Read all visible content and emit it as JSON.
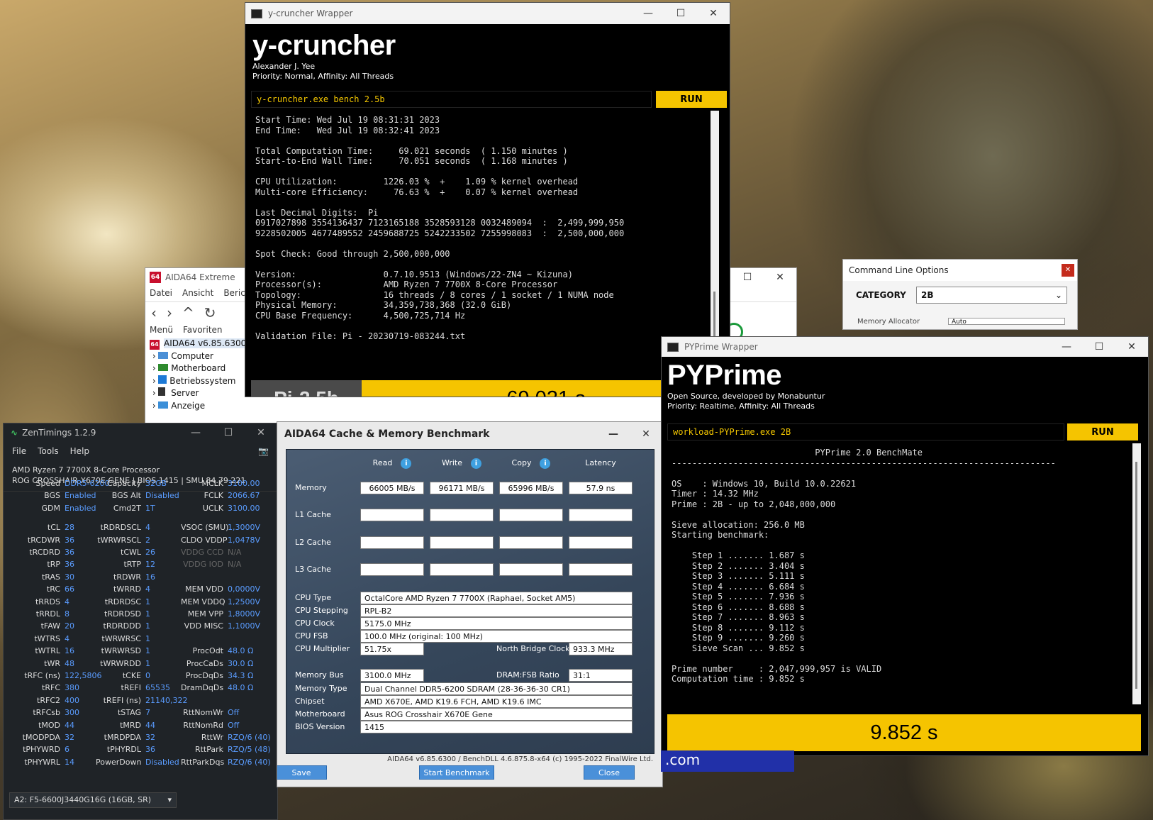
{
  "ycruncher": {
    "window_title": "y-cruncher Wrapper",
    "app_title": "y-cruncher",
    "author": "Alexander J. Yee",
    "priority": "Priority: Normal, Affinity: All Threads",
    "command": "y-cruncher.exe bench 2.5b",
    "run_label": "RUN",
    "console_lines": [
      "Start Time: Wed Jul 19 08:31:31 2023",
      "End Time:   Wed Jul 19 08:32:41 2023",
      "",
      "Total Computation Time:     69.021 seconds  ( 1.150 minutes )",
      "Start-to-End Wall Time:     70.051 seconds  ( 1.168 minutes )",
      "",
      "CPU Utilization:         1226.03 %  +    1.09 % kernel overhead",
      "Multi-core Efficiency:     76.63 %  +    0.07 % kernel overhead",
      "",
      "Last Decimal Digits:  Pi",
      "0917027898 3554136437 7123165188 3528593128 0032489094  :  2,499,999,950",
      "9228502005 4677489552 2459688725 5242233502 7255998083  :  2,500,000,000",
      "",
      "Spot Check: Good through 2,500,000,000",
      "",
      "Version:                 0.7.10.9513 (Windows/22-ZN4 ~ Kizuna)",
      "Processor(s):            AMD Ryzen 7 7700X 8-Core Processor",
      "Topology:                16 threads / 8 cores / 1 socket / 1 NUMA node",
      "Physical Memory:         34,359,738,368 (32.0 GiB)",
      "CPU Base Frequency:      4,500,725,714 Hz",
      "",
      "Validation File: Pi - 20230719-083244.txt"
    ],
    "bench_name": "Pi-2.5b",
    "result": "69.021 s"
  },
  "aida_extreme": {
    "title": "AIDA64 Extreme",
    "menu": [
      "Datei",
      "Ansicht",
      "Bericht"
    ],
    "tabs": [
      "Menü",
      "Favoriten"
    ],
    "tree": [
      "AIDA64 v6.85.6300",
      "Computer",
      "Motherboard",
      "Betriebssystem",
      "Server",
      "Anzeige"
    ]
  },
  "cmdline": {
    "title": "Command Line Options",
    "category_label": "CATEGORY",
    "category_value": "2B",
    "hidden_label": "Memory Allocator",
    "hidden_value": "Auto"
  },
  "zentimings": {
    "title": "ZenTimings 1.2.9",
    "menu": [
      "File",
      "Tools",
      "Help"
    ],
    "cpu": "AMD Ryzen 7 7700X 8-Core Processor",
    "board": "ROG CROSSHAIR X670E GENE | BIOS 1415 | SMU 84.79.221",
    "rows": [
      [
        [
          "Speed",
          "DDR5-6200"
        ],
        [
          "Capacity",
          "32GB"
        ],
        [
          "MCLK",
          "3100.00"
        ]
      ],
      [
        [
          "BGS",
          "Enabled"
        ],
        [
          "BGS Alt",
          "Disabled"
        ],
        [
          "FCLK",
          "2066.67"
        ]
      ],
      [
        [
          "GDM",
          "Enabled"
        ],
        [
          "Cmd2T",
          "1T"
        ],
        [
          "UCLK",
          "3100.00"
        ]
      ],
      [],
      [
        [
          "tCL",
          "28"
        ],
        [
          "tRDRDSCL",
          "4"
        ],
        [
          "VSOC (SMU)",
          "1,3000V"
        ]
      ],
      [
        [
          "tRCDWR",
          "36"
        ],
        [
          "tWRWRSCL",
          "2"
        ],
        [
          "CLDO VDDP",
          "1,0478V"
        ]
      ],
      [
        [
          "tRCDRD",
          "36"
        ],
        [
          "tCWL",
          "26"
        ],
        [
          "VDDG CCD",
          "N/A"
        ]
      ],
      [
        [
          "tRP",
          "36"
        ],
        [
          "tRTP",
          "12"
        ],
        [
          "VDDG IOD",
          "N/A"
        ]
      ],
      [
        [
          "tRAS",
          "30"
        ],
        [
          "tRDWR",
          "16"
        ],
        [
          "",
          ""
        ]
      ],
      [
        [
          "tRC",
          "66"
        ],
        [
          "tWRRD",
          "4"
        ],
        [
          "MEM VDD",
          "0,0000V"
        ]
      ],
      [
        [
          "tRRDS",
          "4"
        ],
        [
          "tRDRDSC",
          "1"
        ],
        [
          "MEM VDDQ",
          "1,2500V"
        ]
      ],
      [
        [
          "tRRDL",
          "8"
        ],
        [
          "tRDRDSD",
          "1"
        ],
        [
          "MEM VPP",
          "1,8000V"
        ]
      ],
      [
        [
          "tFAW",
          "20"
        ],
        [
          "tRDRDDD",
          "1"
        ],
        [
          "VDD MISC",
          "1,1000V"
        ]
      ],
      [
        [
          "tWTRS",
          "4"
        ],
        [
          "tWRWRSC",
          "1"
        ],
        [
          "",
          ""
        ]
      ],
      [
        [
          "tWTRL",
          "16"
        ],
        [
          "tWRWRSD",
          "1"
        ],
        [
          "ProcOdt",
          "48.0 Ω"
        ]
      ],
      [
        [
          "tWR",
          "48"
        ],
        [
          "tWRWRDD",
          "1"
        ],
        [
          "ProcCaDs",
          "30.0 Ω"
        ]
      ],
      [
        [
          "tRFC (ns)",
          "122,5806"
        ],
        [
          "tCKE",
          "0"
        ],
        [
          "ProcDqDs",
          "34.3 Ω"
        ]
      ],
      [
        [
          "tRFC",
          "380"
        ],
        [
          "tREFI",
          "65535"
        ],
        [
          "DramDqDs",
          "48.0 Ω"
        ]
      ],
      [
        [
          "tRFC2",
          "400"
        ],
        [
          "tREFI (ns)",
          "21140,322"
        ],
        [
          "",
          ""
        ]
      ],
      [
        [
          "tRFCsb",
          "300"
        ],
        [
          "tSTAG",
          "7"
        ],
        [
          "RttNomWr",
          "Off"
        ]
      ],
      [
        [
          "tMOD",
          "44"
        ],
        [
          "tMRD",
          "44"
        ],
        [
          "RttNomRd",
          "Off"
        ]
      ],
      [
        [
          "tMODPDA",
          "32"
        ],
        [
          "tMRDPDA",
          "32"
        ],
        [
          "RttWr",
          "RZQ/6 (40)"
        ]
      ],
      [
        [
          "tPHYWRD",
          "6"
        ],
        [
          "tPHYRDL",
          "36"
        ],
        [
          "RttPark",
          "RZQ/5 (48)"
        ]
      ],
      [
        [
          "tPHYWRL",
          "14"
        ],
        [
          "PowerDown",
          "Disabled"
        ],
        [
          "RttParkDqs",
          "RZQ/6 (40)"
        ]
      ]
    ],
    "dimm": "A2: F5-6600J3440G16G (16GB, SR)"
  },
  "bench": {
    "title": "AIDA64 Cache & Memory Benchmark",
    "headers": [
      "Read",
      "Write",
      "Copy",
      "Latency"
    ],
    "rows": [
      {
        "label": "Memory",
        "values": [
          "66005 MB/s",
          "96171 MB/s",
          "65996 MB/s",
          "57.9 ns"
        ]
      },
      {
        "label": "L1 Cache",
        "values": [
          "",
          "",
          "",
          ""
        ]
      },
      {
        "label": "L2 Cache",
        "values": [
          "",
          "",
          "",
          ""
        ]
      },
      {
        "label": "L3 Cache",
        "values": [
          "",
          "",
          "",
          ""
        ]
      }
    ],
    "info": [
      {
        "label": "CPU Type",
        "value": "OctalCore AMD Ryzen 7 7700X  (Raphael, Socket AM5)"
      },
      {
        "label": "CPU Stepping",
        "value": "RPL-B2"
      },
      {
        "label": "CPU Clock",
        "value": "5175.0 MHz"
      },
      {
        "label": "CPU FSB",
        "value": "100.0 MHz  (original: 100 MHz)"
      }
    ],
    "cpu_multiplier_label": "CPU Multiplier",
    "cpu_multiplier": "51.75x",
    "nb_label": "North Bridge Clock",
    "nb_value": "933.3 MHz",
    "membus_label": "Memory Bus",
    "membus": "3100.0 MHz",
    "ratio_label": "DRAM:FSB Ratio",
    "ratio": "31:1",
    "info2": [
      {
        "label": "Memory Type",
        "value": "Dual Channel DDR5-6200 SDRAM  (28-36-36-30 CR1)"
      },
      {
        "label": "Chipset",
        "value": "AMD X670E, AMD K19.6 FCH, AMD K19.6 IMC"
      },
      {
        "label": "Motherboard",
        "value": "Asus ROG Crosshair X670E Gene"
      },
      {
        "label": "BIOS Version",
        "value": "1415"
      }
    ],
    "footer": "AIDA64 v6.85.6300 / BenchDLL 4.6.875.8-x64  (c) 1995-2022 FinalWire Ltd.",
    "save": "Save",
    "start": "Start Benchmark",
    "close": "Close"
  },
  "pyprime": {
    "window_title": "PYPrime Wrapper",
    "app_title": "PYPrime",
    "sub1": "Open Source, developed by Monabuntur",
    "sub2": "Priority: Realtime, Affinity: All Threads",
    "command": "workload-PYPrime.exe 2B",
    "run_label": "RUN",
    "console_lines": [
      "                            PYPrime 2.0 BenchMate",
      "---------------------------------------------------------------------------",
      "",
      "OS    : Windows 10, Build 10.0.22621",
      "Timer : 14.32 MHz",
      "Prime : 2B - up to 2,048,000,000",
      "",
      "Sieve allocation: 256.0 MB",
      "Starting benchmark:",
      "",
      "    Step 1 ....... 1.687 s",
      "    Step 2 ....... 3.404 s",
      "    Step 3 ....... 5.111 s",
      "    Step 4 ....... 6.684 s",
      "    Step 5 ....... 7.936 s",
      "    Step 6 ....... 8.688 s",
      "    Step 7 ....... 8.963 s",
      "    Step 8 ....... 9.112 s",
      "    Step 9 ....... 9.260 s",
      "    Sieve Scan ... 9.852 s",
      "",
      "Prime number     : 2,047,999,957 is VALID",
      "Computation time : 9.852 s"
    ],
    "result": "9.852 s"
  },
  "bottom_link": ".com",
  "colors": {
    "accent_yellow": "#f5c400",
    "zen_value": "#5a9cff",
    "aida_red": "#c8102e"
  }
}
